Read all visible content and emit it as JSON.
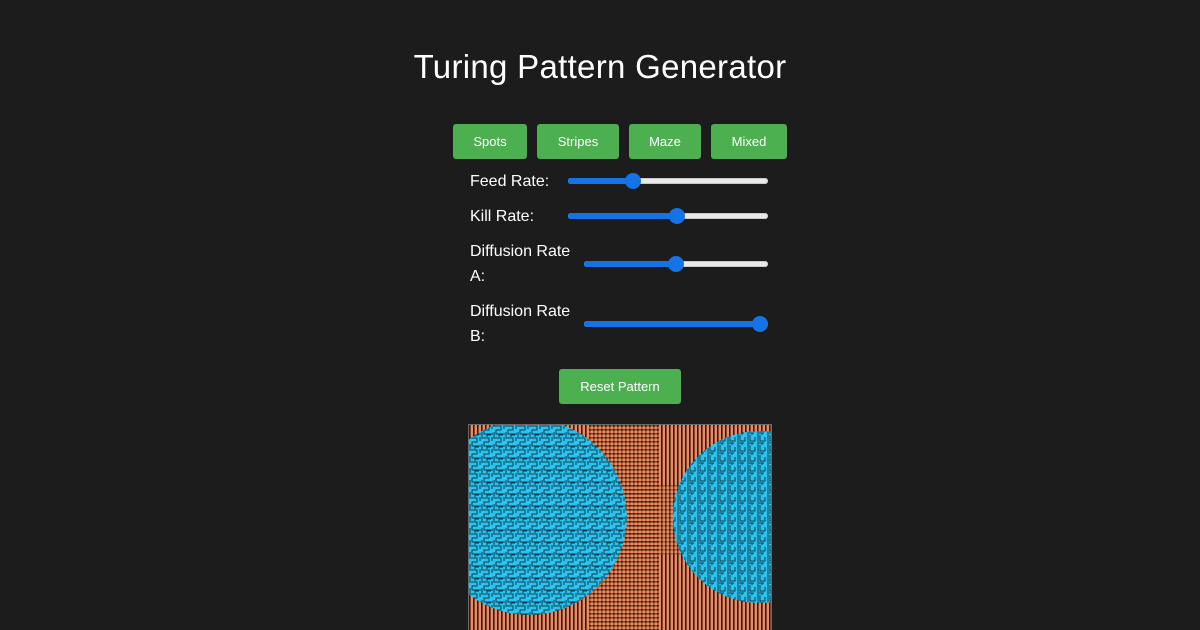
{
  "title": "Turing Pattern Generator",
  "presets": {
    "spots": "Spots",
    "stripes": "Stripes",
    "maze": "Maze",
    "mixed": "Mixed"
  },
  "controls": {
    "feed_rate": {
      "label": "Feed Rate:",
      "value": 0.31
    },
    "kill_rate": {
      "label": "Kill Rate:",
      "value": 0.55
    },
    "diffusion_a": {
      "label_line1": "Diffusion Rate",
      "label_line2": "A:",
      "value": 0.5
    },
    "diffusion_b": {
      "label_line1": "Diffusion Rate",
      "label_line2": "B:",
      "value": 1.0
    }
  },
  "reset_label": "Reset Pattern",
  "colors": {
    "background": "#1c1c1c",
    "button": "#4caf50",
    "slider_accent": "#1473e6",
    "pattern_blue": "#29c4ef",
    "pattern_orange": "#f08a5a",
    "pattern_dark": "#1a1a1a"
  }
}
